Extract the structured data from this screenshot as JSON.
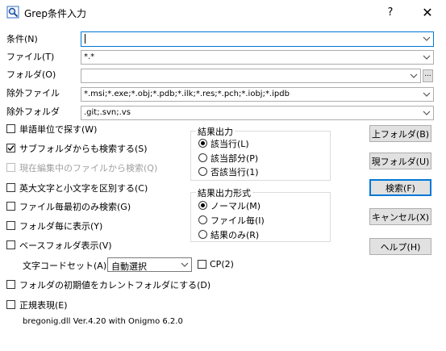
{
  "window": {
    "title": "Grep条件入力",
    "help_label": "?",
    "close_label": "✕"
  },
  "fields": {
    "condition_label": "条件(N)",
    "condition_value": "",
    "file_label": "ファイル(T)",
    "file_value": "*.*",
    "folder_label": "フォルダ(O)",
    "folder_value": "",
    "browse_label": "...",
    "exclude_file_label": "除外ファイル",
    "exclude_file_value": "*.msi;*.exe;*.obj;*.pdb;*.ilk;*.res;*.pch;*.iobj;*.ipdb",
    "exclude_folder_label": "除外フォルダ",
    "exclude_folder_value": ".git;.svn;.vs"
  },
  "options": [
    {
      "label": "単語単位で探す(W)",
      "checked": false,
      "disabled": false
    },
    {
      "label": "サブフォルダからも検索する(S)",
      "checked": true,
      "disabled": false
    },
    {
      "label": "現在編集中のファイルから検索(Q)",
      "checked": false,
      "disabled": true
    },
    {
      "label": "英大文字と小文字を区別する(C)",
      "checked": false,
      "disabled": false
    },
    {
      "label": "ファイル毎最初のみ検索(G)",
      "checked": false,
      "disabled": false
    },
    {
      "label": "フォルダ毎に表示(Y)",
      "checked": false,
      "disabled": false
    },
    {
      "label": "ベースフォルダ表示(V)",
      "checked": false,
      "disabled": false
    }
  ],
  "result_output": {
    "title": "結果出力",
    "items": [
      {
        "label": "該当行(L)",
        "selected": true
      },
      {
        "label": "該当部分(P)",
        "selected": false
      },
      {
        "label": "否該当行(1)",
        "selected": false
      }
    ]
  },
  "result_format": {
    "title": "結果出力形式",
    "items": [
      {
        "label": "ノーマル(M)",
        "selected": true
      },
      {
        "label": "ファイル毎(I)",
        "selected": false
      },
      {
        "label": "結果のみ(R)",
        "selected": false
      }
    ]
  },
  "encoding": {
    "label": "文字コードセット(A)",
    "selected": "自動選択",
    "cp_label": "CP(2)",
    "cp_checked": false
  },
  "bottom_options": [
    {
      "label": "フォルダの初期値をカレントフォルダにする(D)",
      "checked": false
    },
    {
      "label": "正規表現(E)",
      "checked": false
    }
  ],
  "regex_lib": "bregonig.dll Ver.4.20 with Onigmo 6.2.0",
  "buttons": {
    "up_folder": "上フォルダ(B)",
    "current_folder": "現フォルダ(U)",
    "search": "検索(F)",
    "cancel": "キャンセル(X)",
    "help": "ヘルプ(H)"
  }
}
